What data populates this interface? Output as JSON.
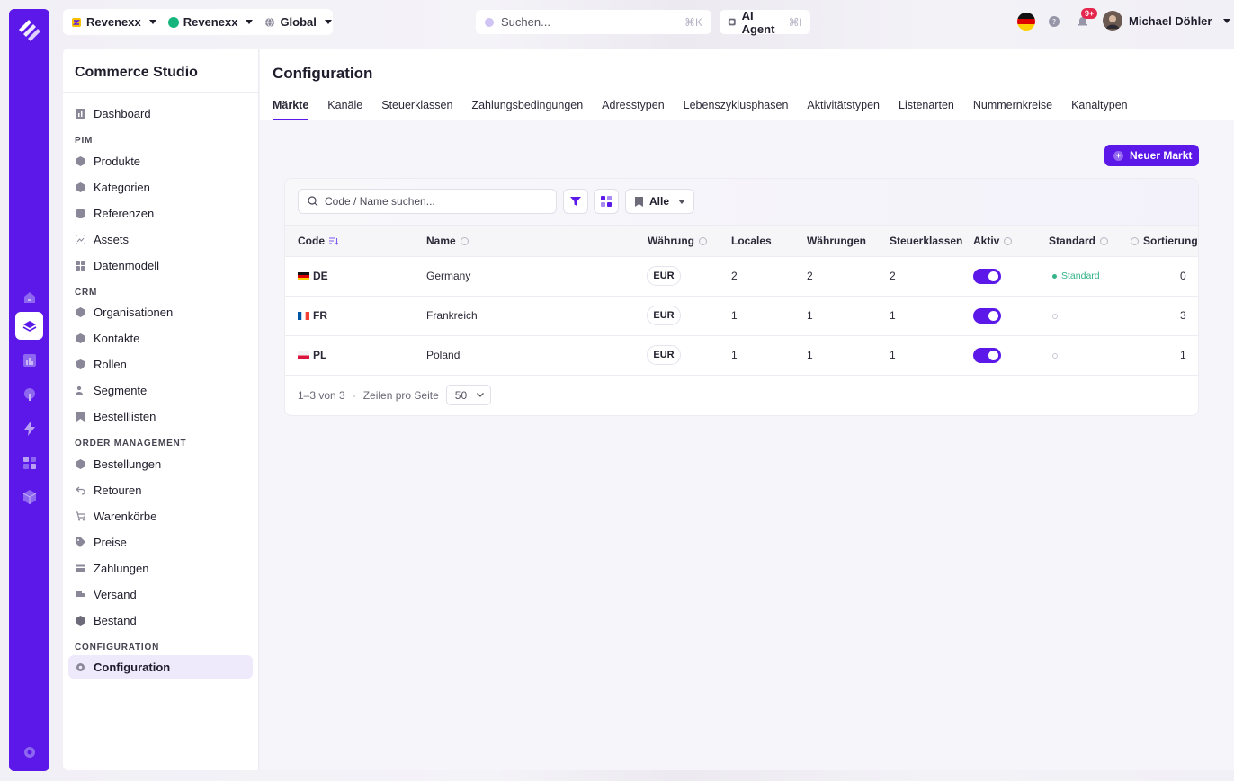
{
  "topbar": {
    "org": "Revenexx",
    "shop": "Revenexx",
    "scope": "Global",
    "search_placeholder": "Suchen...",
    "search_shortcut": "⌘K",
    "ai_label": "AI Agent",
    "ai_shortcut": "⌘I",
    "notifications_badge": "9+",
    "user_name": "Michael Döhler"
  },
  "sidebar": {
    "title": "Commerce Studio",
    "dashboard": "Dashboard",
    "sections": {
      "pim": "PIM",
      "crm": "CRM",
      "orders": "ORDER MANAGEMENT",
      "config": "CONFIGURATION"
    },
    "pim_items": [
      "Produkte",
      "Kategorien",
      "Referenzen",
      "Assets",
      "Datenmodell"
    ],
    "crm_items": [
      "Organisationen",
      "Kontakte",
      "Rollen",
      "Segmente",
      "Bestelllisten"
    ],
    "order_items": [
      "Bestellungen",
      "Retouren",
      "Warenkörbe",
      "Preise",
      "Zahlungen",
      "Versand",
      "Bestand"
    ],
    "config_item": "Configuration"
  },
  "main": {
    "title": "Configuration",
    "tabs": [
      "Märkte",
      "Kanäle",
      "Steuerklassen",
      "Zahlungsbedingungen",
      "Adresstypen",
      "Lebenszyklusphasen",
      "Aktivitätstypen",
      "Listenarten",
      "Nummernkreise",
      "Kanaltypen"
    ],
    "new_button": "Neuer Markt"
  },
  "table": {
    "search_placeholder": "Code / Name suchen...",
    "filter_all": "Alle",
    "columns": {
      "code": "Code",
      "name": "Name",
      "currency": "Währung",
      "locales": "Locales",
      "currencies": "Währungen",
      "taxclasses": "Steuerklassen",
      "active": "Aktiv",
      "standard": "Standard",
      "sort": "Sortierung"
    },
    "rows": [
      {
        "code": "DE",
        "name": "Germany",
        "currency": "EUR",
        "locales": "2",
        "currencies": "2",
        "taxclasses": "2",
        "active": true,
        "standard": "Standard",
        "sort": "0"
      },
      {
        "code": "FR",
        "name": "Frankreich",
        "currency": "EUR",
        "locales": "1",
        "currencies": "1",
        "taxclasses": "1",
        "active": true,
        "standard": "",
        "sort": "3"
      },
      {
        "code": "PL",
        "name": "Poland",
        "currency": "EUR",
        "locales": "1",
        "currencies": "1",
        "taxclasses": "1",
        "active": true,
        "standard": "",
        "sort": "1"
      }
    ],
    "pager": {
      "range": "1–3 von 3",
      "separator": "-",
      "rows_label": "Zeilen pro Seite",
      "page_size": "50"
    }
  },
  "colors": {
    "accent": "#5c18e8",
    "success": "#35b387",
    "badge": "#e5264d"
  }
}
